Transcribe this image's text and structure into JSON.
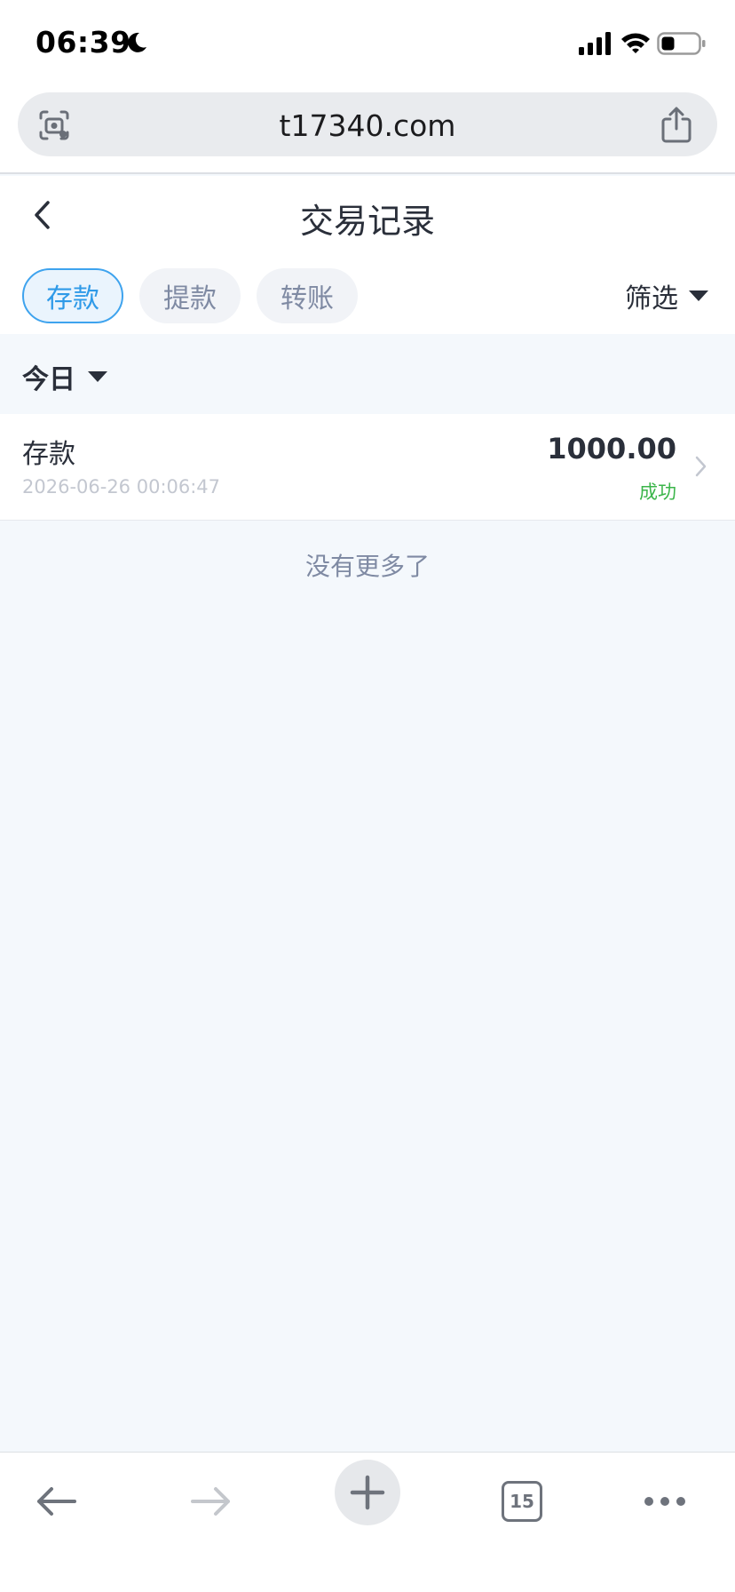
{
  "status_bar": {
    "time": "06:39",
    "icons": [
      "moon-icon",
      "signal-icon",
      "wifi-icon",
      "battery-icon"
    ]
  },
  "browser": {
    "url": "t17340.com",
    "icons": [
      "lens-icon",
      "share-icon"
    ],
    "tabs_count": "15",
    "toolbar_icons": [
      "arrow-left-icon",
      "arrow-right-icon",
      "plus-icon",
      "tabs-icon",
      "more-icon"
    ]
  },
  "header": {
    "title": "交易记录",
    "back_icon": "chevron-left-icon"
  },
  "tabs": [
    {
      "label": "存款",
      "active": true
    },
    {
      "label": "提款",
      "active": false
    },
    {
      "label": "转账",
      "active": false
    }
  ],
  "filter": {
    "label": "筛选"
  },
  "date_group": {
    "label": "今日"
  },
  "records": [
    {
      "type": "存款",
      "time": "2026-06-26 00:06:47",
      "amount": "1000.00",
      "status": "成功"
    }
  ],
  "footer_text": "没有更多了",
  "colors": {
    "accent": "#2f9ae8",
    "success": "#3bb54a",
    "page_background": "#f4f8fc"
  }
}
